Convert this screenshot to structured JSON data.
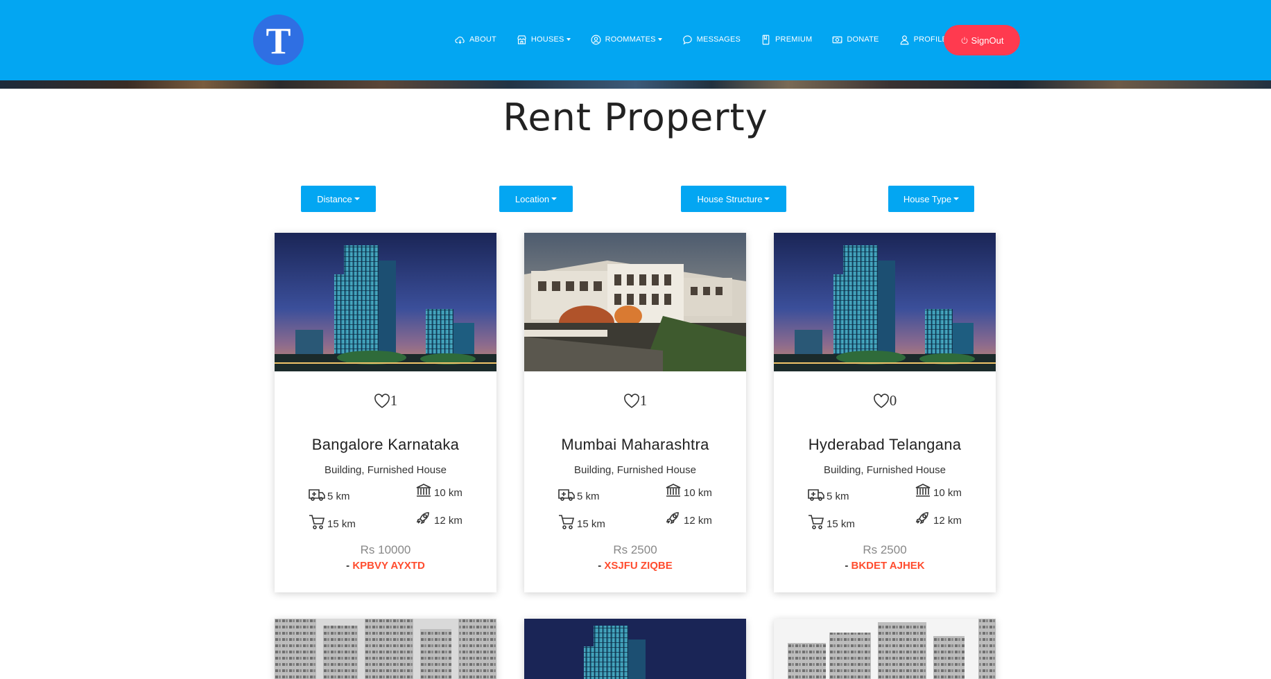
{
  "brand": {
    "logo_letter": "T"
  },
  "nav": {
    "items": [
      {
        "label": "ABOUT",
        "icon": "cloud-icon"
      },
      {
        "label": "HOUSES",
        "icon": "store-icon",
        "dropdown": true
      },
      {
        "label": "ROOMMATES",
        "icon": "user-circle-icon",
        "dropdown": true
      },
      {
        "label": "MESSAGES",
        "icon": "chat-icon"
      },
      {
        "label": "PREMIUM",
        "icon": "book-icon"
      },
      {
        "label": "DONATE",
        "icon": "money-icon"
      },
      {
        "label": "PROFILE",
        "icon": "person-icon"
      }
    ],
    "signout_label": "SignOut"
  },
  "page": {
    "title": "Rent Property"
  },
  "filters": [
    {
      "label": "Distance"
    },
    {
      "label": "Location"
    },
    {
      "label": "House Structure"
    },
    {
      "label": "House Type"
    }
  ],
  "listings": [
    {
      "likes": "1",
      "city": "Bangalore Karnataka",
      "description": "Building, Furnished House",
      "hospital": "5 km",
      "bank": "10 km",
      "shop": "15 km",
      "transport": "12 km",
      "price": "Rs 10000",
      "owner_prefix": "- ",
      "owner": "KPBVY AYXTD",
      "image": "glass-tower-night"
    },
    {
      "likes": "1",
      "city": "Mumbai Maharashtra",
      "description": "Building, Furnished House",
      "hospital": "5 km",
      "bank": "10 km",
      "shop": "15 km",
      "transport": "12 km",
      "price": "Rs 2500",
      "owner_prefix": "- ",
      "owner": "XSJFU ZIQBE",
      "image": "apartment-complex-garden"
    },
    {
      "likes": "0",
      "city": "Hyderabad Telangana",
      "description": "Building, Furnished House",
      "hospital": "5 km",
      "bank": "10 km",
      "shop": "15 km",
      "transport": "12 km",
      "price": "Rs 2500",
      "owner_prefix": "- ",
      "owner": "BKDET AJHEK",
      "image": "glass-tower-night"
    }
  ],
  "colors": {
    "nav": "#03a6f2",
    "signout": "#ff3a4f",
    "owner_code": "#ff4c2e",
    "logo": "#2f6fe3"
  }
}
